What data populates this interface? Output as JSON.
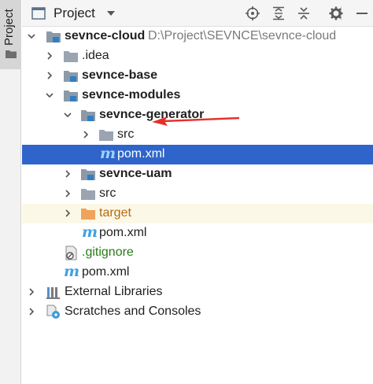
{
  "toolstrip": {
    "tab_label": "Project"
  },
  "header": {
    "title": "Project",
    "icons": [
      "locate-icon",
      "expand-all-icon",
      "collapse-all-icon",
      "settings-icon",
      "hide-icon"
    ]
  },
  "tree": [
    {
      "label": "sevnce-cloud",
      "path": "D:\\Project\\SEVNCE\\sevnce-cloud",
      "icon": "module-folder-icon",
      "expanded": true
    },
    {
      "label": ".idea",
      "icon": "folder-icon",
      "expanded": false
    },
    {
      "label": "sevnce-base",
      "icon": "module-folder-icon",
      "expanded": false
    },
    {
      "label": "sevnce-modules",
      "icon": "module-folder-icon",
      "expanded": true
    },
    {
      "label": "sevnce-generator",
      "icon": "module-folder-icon",
      "expanded": true
    },
    {
      "label": "src",
      "icon": "folder-icon",
      "expanded": false
    },
    {
      "label": "pom.xml",
      "icon": "maven-icon",
      "selected": true
    },
    {
      "label": "sevnce-uam",
      "icon": "module-folder-icon",
      "expanded": false
    },
    {
      "label": "src",
      "icon": "folder-icon",
      "expanded": false
    },
    {
      "label": "target",
      "icon": "excluded-folder-icon",
      "expanded": false
    },
    {
      "label": "pom.xml",
      "icon": "maven-icon"
    },
    {
      "label": ".gitignore",
      "icon": "gitignore-file-icon"
    },
    {
      "label": "pom.xml",
      "icon": "maven-icon"
    },
    {
      "label": "External Libraries",
      "icon": "libraries-icon",
      "expanded": false
    },
    {
      "label": "Scratches and Consoles",
      "icon": "scratches-icon",
      "expanded": false
    }
  ],
  "maven_glyph": "m",
  "colors": {
    "selection": "#2f65ca",
    "excluded_row": "#fcf8e7",
    "arrow_annotation": "#e5302a",
    "maven": "#3fa0e6"
  }
}
